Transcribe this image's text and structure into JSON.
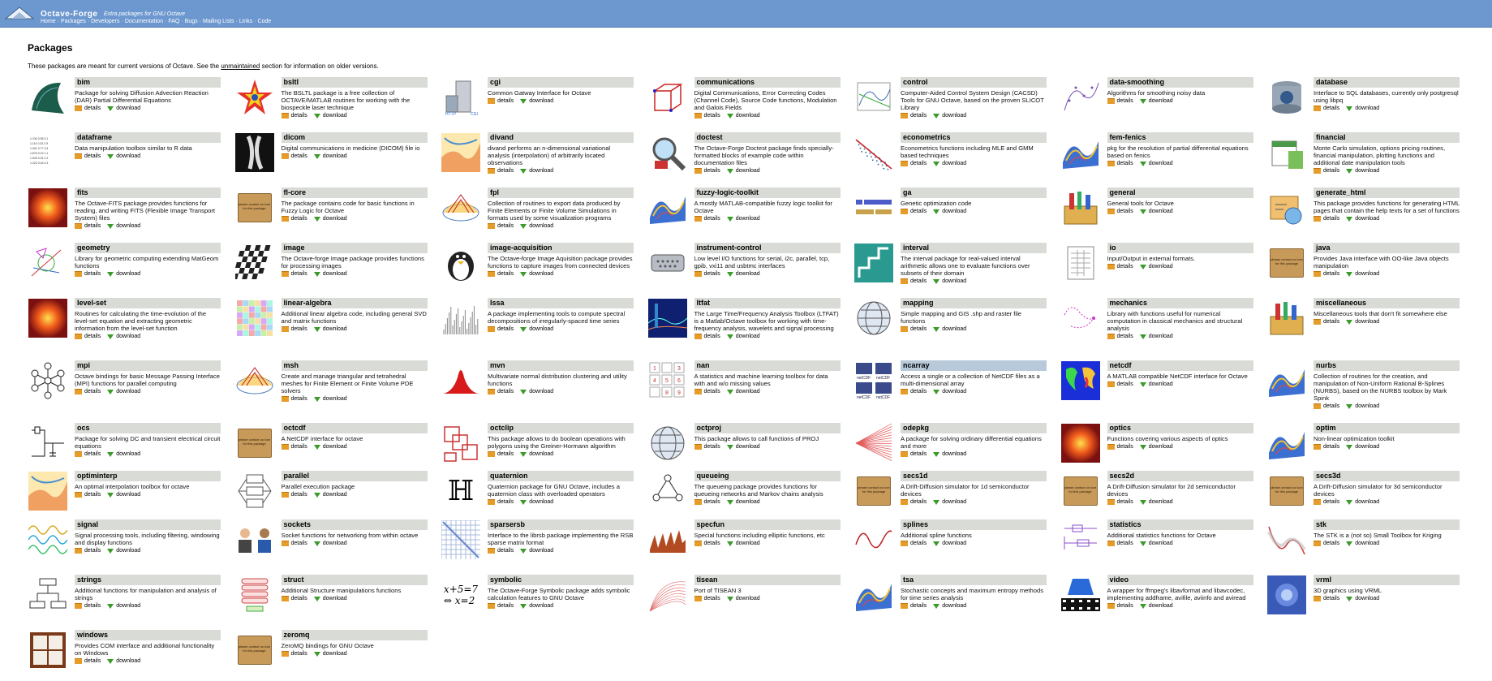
{
  "header": {
    "title": "Octave-Forge",
    "subtitle": "Extra packages for GNU Octave",
    "nav": [
      "Home",
      "Packages",
      "Developers",
      "Documentation",
      "FAQ",
      "Bugs",
      "Mailing Lists",
      "Links",
      "Code"
    ]
  },
  "page": {
    "title": "Packages",
    "intro_before": "These packages are meant for current versions of Octave. See the ",
    "intro_link": "unmaintained",
    "intro_after": " section for information on older versions."
  },
  "labels": {
    "details": "details",
    "download": "download"
  },
  "colors": {
    "header": "#6d98cf",
    "pkg_header": "#d9dcd6",
    "highlight": "#b8c9da",
    "folder": "#e69c28",
    "arrow": "#3c9a2a"
  },
  "packages": [
    {
      "name": "bim",
      "desc": "Package for solving Diffusion Advection Reaction (DAR) Partial Differential Equations",
      "icon": "gradient-mesh-icon"
    },
    {
      "name": "bsltl",
      "desc": "The BSLTL package is a free collection of OCTAVE/MATLAB routines for working with the biospeckle laser technique",
      "icon": "star-icon"
    },
    {
      "name": "cgi",
      "desc": "Common Gatway Interface for Octave",
      "icon": "server-icon"
    },
    {
      "name": "communications",
      "desc": "Digital Communications, Error Correcting Codes (Channel Code), Source Code functions, Modulation and Galois Fields",
      "icon": "cube-icon"
    },
    {
      "name": "control",
      "desc": "Computer-Aided Control System Design (CACSD) Tools for GNU Octave, based on the proven SLICOT Library",
      "icon": "plot-icon"
    },
    {
      "name": "data-smoothing",
      "desc": "Algorithms for smoothing noisy data",
      "icon": "scatter-icon"
    },
    {
      "name": "database",
      "desc": "Interface to SQL databases, currently only postgresql using libpq",
      "icon": "database-icon"
    },
    {
      "name": "dataframe",
      "desc": "Data manipulation toolbox similar to R data",
      "icon": "table-icon"
    },
    {
      "name": "dicom",
      "desc": "Digital communications in medicine (DICOM) file io",
      "icon": "xray-icon"
    },
    {
      "name": "divand",
      "desc": "divand performs an n-dimensional variational analysis (interpolation) of arbitrarily located observations",
      "icon": "map-icon"
    },
    {
      "name": "doctest",
      "desc": "The Octave-Forge Doctest package finds specially-formatted blocks of example code within documentation files",
      "icon": "magnifier-icon"
    },
    {
      "name": "econometrics",
      "desc": "Econometrics functions including MLE and GMM based techniques",
      "icon": "regression-icon"
    },
    {
      "name": "fem-fenics",
      "desc": "pkg for the resolution of partial differential equations based on fenics",
      "icon": "surface-icon"
    },
    {
      "name": "financial",
      "desc": "Monte Carlo simulation, options pricing routines, financial manipulation, plotting functions and additional date manipulation tools",
      "icon": "calendar-icon"
    },
    {
      "name": "fits",
      "desc": "The Octave-FITS package provides functions for reading, and writing FITS (Flexible Image Transport System) files",
      "icon": "heatmap-icon"
    },
    {
      "name": "fl-core",
      "desc": "The package contains code for basic functions in Fuzzy Logic for Octave",
      "icon": "package-box-icon"
    },
    {
      "name": "fpl",
      "desc": "Collection of routines to export data produced by Finite Elements or Finite Volume Simulations in formats used by some visualization programs",
      "icon": "mesh-icon"
    },
    {
      "name": "fuzzy-logic-toolkit",
      "desc": "A mostly MATLAB-compatible fuzzy logic toolkit for Octave",
      "icon": "surface-icon"
    },
    {
      "name": "ga",
      "desc": "Genetic optimization code",
      "icon": "chromosome-icon"
    },
    {
      "name": "general",
      "desc": "General tools for Octave",
      "icon": "toolbox-icon"
    },
    {
      "name": "generate_html",
      "desc": "This package provides functions for generating HTML pages that contain the help texts for a set of functions",
      "icon": "html-icon"
    },
    {
      "name": "geometry",
      "desc": "Library for geometric computing extending MatGeom functions",
      "icon": "geometry-icon"
    },
    {
      "name": "image",
      "desc": "The Octave-forge Image package provides functions for processing images",
      "icon": "checker-icon"
    },
    {
      "name": "image-acquisition",
      "desc": "The Octave-forge Image Aquisition package provides functions to capture images from connected devices",
      "icon": "penguin-icon"
    },
    {
      "name": "instrument-control",
      "desc": "Low level I/O functions for serial, i2c, parallel, tcp, gpib, vxi11 and usbtmc interfaces",
      "icon": "connector-icon"
    },
    {
      "name": "interval",
      "desc": "The interval package for real-valued interval arithmetic allows one to evaluate functions over subsets of their domain",
      "icon": "interval-icon"
    },
    {
      "name": "io",
      "desc": "Input/Output in external formats.",
      "icon": "document-icon"
    },
    {
      "name": "java",
      "desc": "Provides Java interface with OO-like Java objects manipulation",
      "icon": "package-box-icon"
    },
    {
      "name": "level-set",
      "desc": "Routines for calculating the time-evolution of the level-set equation and extracting geometric information from the level-set function",
      "icon": "heatmap-icon"
    },
    {
      "name": "linear-algebra",
      "desc": "Additional linear algebra code, including general SVD and matrix functions",
      "icon": "matrix-icon"
    },
    {
      "name": "lssa",
      "desc": "A package implementing tools to compute spectral decompositions of irregularly-spaced time series",
      "icon": "spectrum-icon"
    },
    {
      "name": "ltfat",
      "desc": "The Large Time/Frequency Analysis Toolbox (LTFAT) is a Matlab/Octave toolbox for working with time-frequency analysis, wavelets and signal processing",
      "icon": "spectrogram-icon"
    },
    {
      "name": "mapping",
      "desc": "Simple mapping and GIS .shp and raster file functions",
      "icon": "globe-icon"
    },
    {
      "name": "mechanics",
      "desc": "Library with functions useful for numerical computation in classical mechanics and structural analysis",
      "icon": "trajectory-icon"
    },
    {
      "name": "miscellaneous",
      "desc": "Miscellaneous tools that don't fit somewhere else",
      "icon": "toolbox-icon"
    },
    {
      "name": "mpi",
      "desc": "Octave bindings for basic Message Passing Interface (MPI) functions for parallel computing",
      "icon": "network-icon"
    },
    {
      "name": "msh",
      "desc": "Create and manage triangular and tetrahedral meshes for Finite Element or Finite Volume PDE solvers",
      "icon": "mesh-icon"
    },
    {
      "name": "mvn",
      "desc": "Multivariate normal distribution clustering and utility functions",
      "icon": "gaussian-icon"
    },
    {
      "name": "nan",
      "desc": "A statistics and machine learning toolbox for data with and w/o missing values",
      "icon": "number-grid-icon"
    },
    {
      "name": "ncarray",
      "desc": "Access a single or a collection of NetCDF files as a multi-dimensional array",
      "icon": "netcdf-icon",
      "highlight": true
    },
    {
      "name": "netcdf",
      "desc": "A MATLAB compatible NetCDF interface for Octave",
      "icon": "world-map-icon"
    },
    {
      "name": "nurbs",
      "desc": "Collection of routines for the creation, and manipulation of Non-Uniform Rational B-Splines (NURBS), based on the NURBS toolbox by Mark Spink",
      "icon": "surface-icon"
    },
    {
      "name": "ocs",
      "desc": "Package for solving DC and transient electrical circuit equations",
      "icon": "circuit-icon"
    },
    {
      "name": "octcdf",
      "desc": "A NetCDF interface for octave",
      "icon": "package-box-icon"
    },
    {
      "name": "octclip",
      "desc": "This package allows to do boolean operations with polygons using the Greiner-Hormann algorithm",
      "icon": "polygon-icon"
    },
    {
      "name": "octproj",
      "desc": "This package allows to call functions of PROJ",
      "icon": "globe-icon"
    },
    {
      "name": "odepkg",
      "desc": "A package for solving ordinary differential equations and more",
      "icon": "fan-lines-icon"
    },
    {
      "name": "optics",
      "desc": "Functions covering various aspects of optics",
      "icon": "heatmap-icon"
    },
    {
      "name": "optim",
      "desc": "Non-linear optimization toolkit",
      "icon": "surface-icon"
    },
    {
      "name": "optiminterp",
      "desc": "An optimal interpolation toolbox for octave",
      "icon": "map-icon"
    },
    {
      "name": "parallel",
      "desc": "Parallel execution package",
      "icon": "parallel-icon"
    },
    {
      "name": "quaternion",
      "desc": "Quaternion package for GNU Octave, includes a quaternion class with overloaded operators",
      "icon": "quaternion-icon"
    },
    {
      "name": "queueing",
      "desc": "The queueing package provides functions for queueing networks and Markov chains analysis",
      "icon": "queue-icon"
    },
    {
      "name": "secs1d",
      "desc": "A Drift-Diffusion simulator for 1d semiconductor devices",
      "icon": "package-box-icon"
    },
    {
      "name": "secs2d",
      "desc": "A Drift-Diffusion simulator for 2d semiconductor devices",
      "icon": "package-box-icon"
    },
    {
      "name": "secs3d",
      "desc": "A Drift-Diffusion simulator for 3d semiconductor devices",
      "icon": "package-box-icon"
    },
    {
      "name": "signal",
      "desc": "Signal processing tools, including filtering, windowing and display functions",
      "icon": "signal-icon"
    },
    {
      "name": "sockets",
      "desc": "Socket functions for networking from within octave",
      "icon": "people-icon"
    },
    {
      "name": "sparsersb",
      "desc": "Interface to the librsb package implementing the RSB sparse matrix format",
      "icon": "sparse-icon"
    },
    {
      "name": "specfun",
      "desc": "Special functions including ellipitic functions, etc",
      "icon": "wave-surface-icon"
    },
    {
      "name": "splines",
      "desc": "Additional spline functions",
      "icon": "spline-icon"
    },
    {
      "name": "statistics",
      "desc": "Additional statistics functions for Octave",
      "icon": "boxplot-icon"
    },
    {
      "name": "stk",
      "desc": "The STK is a (not so) Small Toolbox for Kriging",
      "icon": "kriging-icon"
    },
    {
      "name": "strings",
      "desc": "Additional functions for manipulation and analysis of strings",
      "icon": "flowchart-icon"
    },
    {
      "name": "struct",
      "desc": "Additional Structure manipulations functions",
      "icon": "struct-icon"
    },
    {
      "name": "symbolic",
      "desc": "The Octave-Forge Symbolic package adds symbolic calculation features to GNU Octave",
      "icon": "equation-icon",
      "equation": "x+5=7\n⇔ x=2"
    },
    {
      "name": "tisean",
      "desc": "Port of TISEAN 3",
      "icon": "curves-icon"
    },
    {
      "name": "tsa",
      "desc": "Stochastic concepts and maximum entropy methods for time series analysis",
      "icon": "surface-icon"
    },
    {
      "name": "video",
      "desc": "A wrapper for ffmpeg's libavformat and libavcodec, implementing addframe, avifile, aviinfo and aviread",
      "icon": "video-icon"
    },
    {
      "name": "vrml",
      "desc": "3D graphics using VRML",
      "icon": "vrml-icon"
    },
    {
      "name": "windows",
      "desc": "Provides COM interface and additional functionality on Windows",
      "icon": "window-icon"
    },
    {
      "name": "zeromq",
      "desc": "ZeroMQ bindings for GNU Octave",
      "icon": "package-box-icon"
    }
  ],
  "box_icon_text": "please contact us icon for this package"
}
